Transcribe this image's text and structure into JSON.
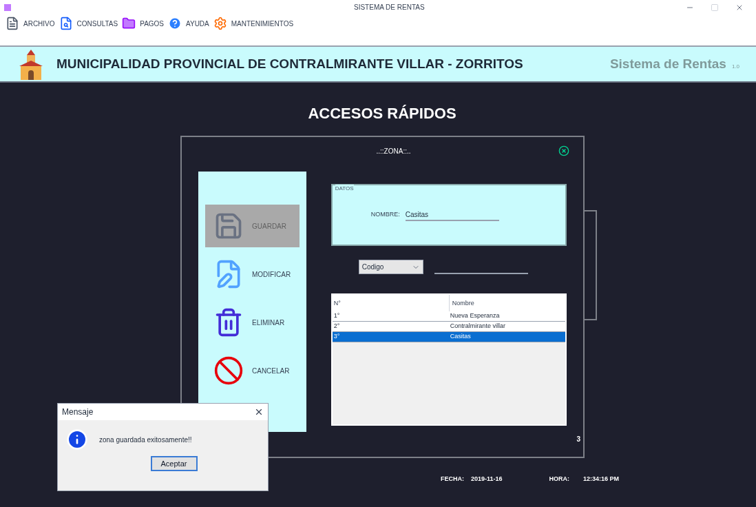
{
  "window": {
    "title": "SISTEMA DE RENTAS"
  },
  "menu": [
    "ARCHIVO",
    "CONSULTAS",
    "PAGOS",
    "AYUDA",
    "MANTENIMIENTOS"
  ],
  "header": {
    "title": "MUNICIPALIDAD PROVINCIAL DE CONTRALMIRANTE VILLAR - ZORRITOS",
    "app_name": "Sistema de Rentas",
    "version": "1.0"
  },
  "heading": "ACCESOS RÁPIDOS",
  "panel": {
    "title": "..::ZONA::..",
    "actions": [
      {
        "kind": "save",
        "label": "GUARDAR",
        "disabled": true
      },
      {
        "kind": "edit",
        "label": "MODIFICAR",
        "disabled": false
      },
      {
        "kind": "delete",
        "label": "ELIMINAR",
        "disabled": false
      },
      {
        "kind": "cancel",
        "label": "CANCELAR",
        "disabled": false
      }
    ],
    "group": {
      "legend": "DATOS",
      "field_label": "NOMBRE:",
      "field_value": "Casitas"
    },
    "search": {
      "filter": "Codigo"
    },
    "table": {
      "columns": [
        "N°",
        "Nombre"
      ],
      "rows": [
        {
          "cells": [
            "1°",
            "Nueva Esperanza"
          ],
          "selected": false
        },
        {
          "cells": [
            "2°",
            "Contralmirante villar"
          ],
          "selected": false
        },
        {
          "cells": [
            "3°",
            "Casitas"
          ],
          "selected": true
        }
      ]
    },
    "count": "3"
  },
  "footer": {
    "date_label": "FECHA:",
    "date": "2019-11-16",
    "time_label": "HORA:",
    "time": "12:34:16 PM"
  },
  "message": {
    "title": "Mensaje",
    "text": "zona guardada exitosamente!!",
    "button": "Aceptar"
  }
}
